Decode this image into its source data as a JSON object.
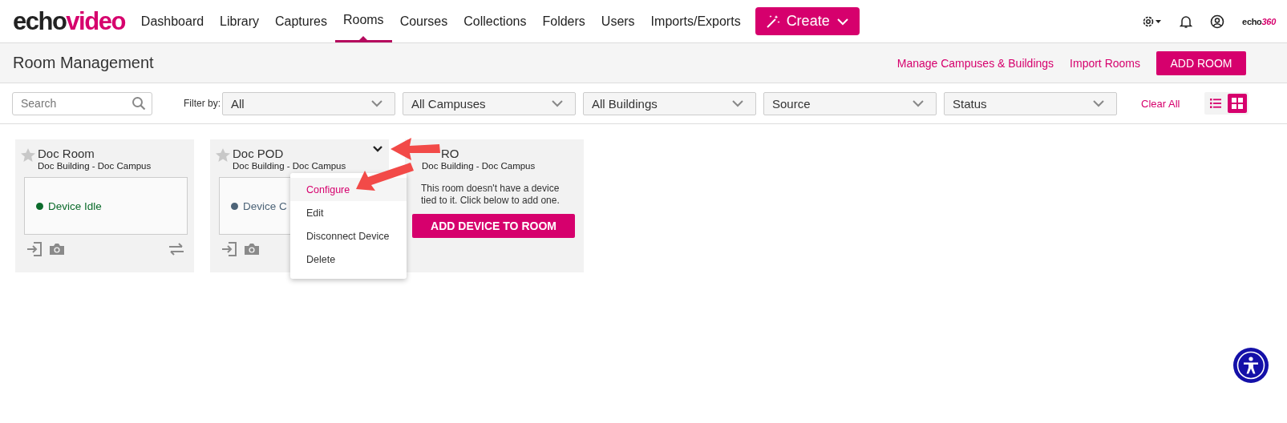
{
  "nav": {
    "logo": {
      "part_a": "echo",
      "part_b": "video"
    },
    "items": [
      {
        "label": "Dashboard",
        "selected": false
      },
      {
        "label": "Library",
        "selected": false
      },
      {
        "label": "Captures",
        "selected": false
      },
      {
        "label": "Rooms",
        "selected": true
      },
      {
        "label": "Courses",
        "selected": false
      },
      {
        "label": "Collections",
        "selected": false
      },
      {
        "label": "Folders",
        "selected": false
      },
      {
        "label": "Users",
        "selected": false
      },
      {
        "label": "Imports/Exports",
        "selected": false
      }
    ],
    "create_button": "Create",
    "brand": {
      "part_a": "echo",
      "part_b": "360"
    }
  },
  "header": {
    "title": "Room Management",
    "links": [
      "Manage Campuses & Buildings",
      "Import Rooms"
    ],
    "add_button": "ADD ROOM"
  },
  "filters": {
    "search": {
      "placeholder": "Search"
    },
    "filter_label": "Filter by:",
    "dropdowns": [
      "All",
      "All Campuses",
      "All Buildings",
      "Source",
      "Status"
    ],
    "clear": "Clear All",
    "views": [
      {
        "kind": "list",
        "selected": false
      },
      {
        "kind": "grid",
        "selected": true
      }
    ]
  },
  "rooms": [
    {
      "kind": "device",
      "title": "Doc Room",
      "subtitle": "Doc Building - Doc Campus",
      "status": "Device Idle",
      "color": "#0b6b2b",
      "swap_icon": true
    },
    {
      "kind": "device",
      "title": "Doc POD",
      "subtitle": "Doc Building - Doc Campus",
      "status": "Device C",
      "color": "#4d6478",
      "swap_icon": false,
      "menu": [
        {
          "label": "Configure",
          "selected": true
        },
        {
          "label": "Edit",
          "selected": false
        },
        {
          "label": "Disconnect Device",
          "selected": false
        },
        {
          "label": "Delete",
          "selected": false
        }
      ]
    },
    {
      "kind": "empty",
      "title": "RO",
      "subtitle": "Doc Building - Doc Campus",
      "message": "This room doesn't have a device tied to it. Click below to add one.",
      "button": "ADD DEVICE TO ROOM"
    }
  ]
}
